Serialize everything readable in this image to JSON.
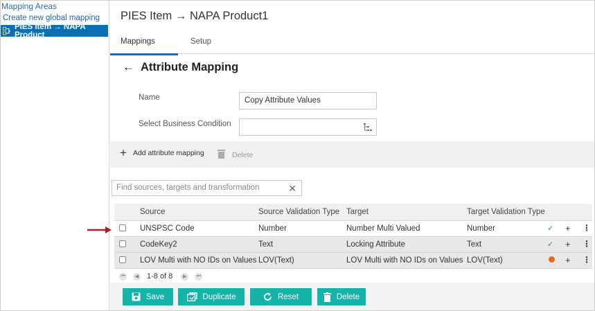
{
  "sidebar": {
    "heading": "Mapping Areas",
    "create_link": "Create new global mapping",
    "active_item": "PIES Item → NAPA Product"
  },
  "header": {
    "title": "PIES Item → NAPA Product1"
  },
  "tabs": [
    {
      "label": "Mappings"
    },
    {
      "label": "Setup"
    }
  ],
  "section": {
    "title": "Attribute Mapping"
  },
  "form": {
    "name_label": "Name",
    "name_value": "Copy Attribute Values",
    "condition_label": "Select Business Condition",
    "condition_value": ""
  },
  "toolbar": {
    "add_label": "Add attribute mapping",
    "delete_label": "Delete"
  },
  "search": {
    "placeholder": "Find sources, targets and transformation"
  },
  "grid": {
    "columns": [
      "Source",
      "Source Validation Type",
      "Target",
      "Target Validation Type"
    ],
    "rows": [
      {
        "source": "UNSPSC Code",
        "source_type": "Number",
        "target": "Number Multi Valued",
        "target_type": "Number",
        "status": "ok"
      },
      {
        "source": "CodeKey2",
        "source_type": "Text",
        "target": "Locking Attribute",
        "target_type": "Text",
        "status": "ok"
      },
      {
        "source": "LOV Multi with NO IDs on Values",
        "source_type": "LOV(Text)",
        "target": "LOV Multi with NO IDs on Values",
        "target_type": "LOV(Text)",
        "status": "warning"
      }
    ]
  },
  "pager": {
    "range": "1-8 of 8"
  },
  "actions": {
    "save": "Save",
    "duplicate": "Duplicate",
    "reset": "Reset",
    "delete": "Delete"
  },
  "colors": {
    "accent": "#0a6fb5",
    "action_button": "#14b5a8",
    "arrow": "#a3232b"
  }
}
